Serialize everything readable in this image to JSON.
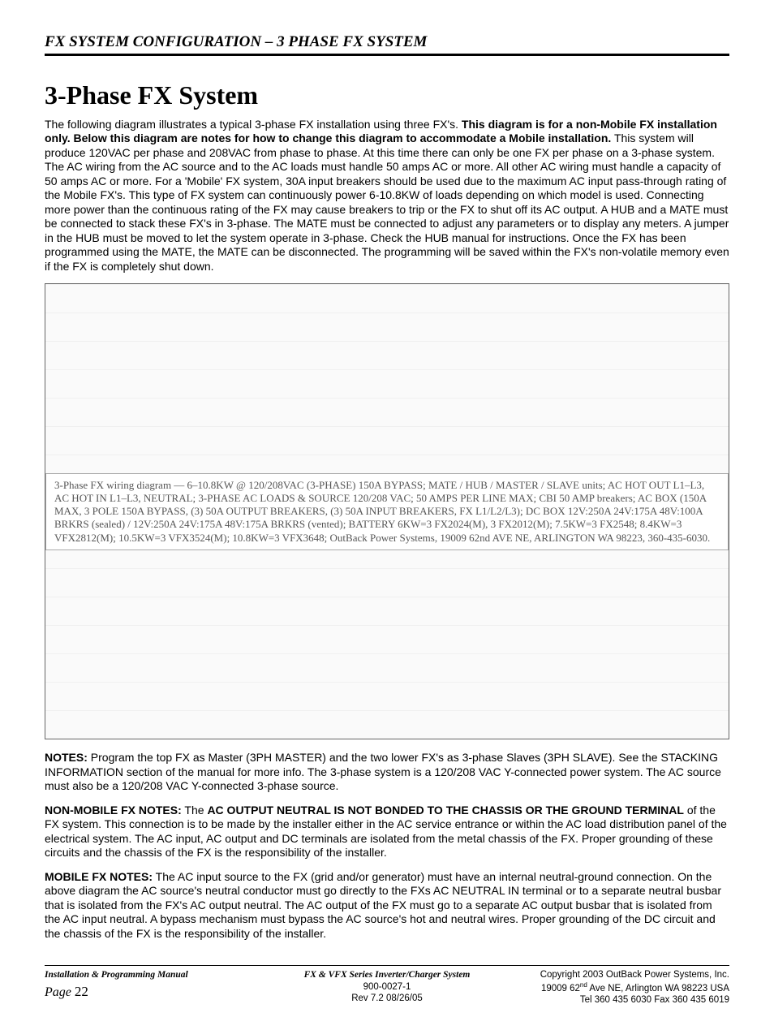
{
  "header": {
    "title": "FX SYSTEM CONFIGURATION – 3 PHASE FX SYSTEM"
  },
  "main": {
    "heading": "3-Phase FX System",
    "intro_lead": "The following diagram illustrates a typical 3-phase FX installation using three FX's.  ",
    "intro_bold": "This diagram is for a non-Mobile FX installation only.  Below this diagram are notes for how to change this diagram to accommodate a Mobile installation.",
    "intro_tail": "  This system will produce 120VAC per phase and 208VAC from phase to phase.  At this time there can only be one FX per phase on a 3-phase system.  The AC wiring from the AC source and to the AC loads must handle 50 amps AC or more.  All other AC wiring must handle a capacity of 50 amps AC or more.  For a 'Mobile' FX system, 30A input breakers should be used due to the maximum AC input pass-through rating of the Mobile FX's.  This type of FX system can continuously power 6-10.8KW of loads depending on which model is used.  Connecting more power than the continuous rating of the FX may cause breakers to trip or the FX to shut off its AC output.  A HUB and a MATE must be connected to stack these FX's in 3-phase.  The MATE must be connected to adjust any parameters or to display any meters.  A jumper in the HUB must be moved to let the system operate in 3-phase.  Check the HUB manual for instructions.  Once the FX has been programmed using the MATE, the MATE can be disconnected.  The programming will be saved within the FX's non-volatile memory even if the FX is completely shut down.",
    "diagram_alt": "3-Phase FX wiring diagram — 6–10.8KW @ 120/208VAC (3-PHASE) 150A BYPASS; MATE / HUB / MASTER / SLAVE units; AC HOT OUT L1–L3, AC HOT IN L1–L3, NEUTRAL; 3-PHASE AC LOADS & SOURCE 120/208 VAC; 50 AMPS PER LINE MAX; CBI 50 AMP breakers; AC BOX (150A MAX, 3 POLE 150A BYPASS, (3) 50A OUTPUT BREAKERS, (3) 50A INPUT BREAKERS, FX L1/L2/L3); DC BOX 12V:250A 24V:175A 48V:100A BRKRS (sealed) / 12V:250A 24V:175A 48V:175A BRKRS (vented); BATTERY 6KW=3 FX2024(M), 3 FX2012(M); 7.5KW=3 FX2548; 8.4KW=3 VFX2812(M); 10.5KW=3 VFX3524(M); 10.8KW=3 VFX3648; OutBack Power Systems, 19009 62nd AVE NE, ARLINGTON WA 98223, 360-435-6030.",
    "notes_label": "NOTES:",
    "notes_text": "  Program the top FX as Master (3PH MASTER) and the two lower FX's as 3-phase Slaves (3PH SLAVE).  See the STACKING INFORMATION section of the manual for more info.  The 3-phase system is a 120/208 VAC Y-connected power system.  The AC source must also be a 120/208 VAC Y-connected 3-phase source.",
    "nonmobile_label": "NON-MOBILE FX NOTES:",
    "nonmobile_lead": "  The ",
    "nonmobile_bold": "AC OUTPUT NEUTRAL IS NOT BONDED TO THE CHASSIS OR THE GROUND TERMINAL",
    "nonmobile_tail": " of the FX system.  This connection is to be made by the installer either in the AC service entrance or within the AC load distribution panel of the electrical system.  The AC input, AC output and DC terminals are isolated from the metal chassis of the FX. Proper grounding of these circuits and the chassis of the FX is the responsibility of the installer.",
    "mobile_label": "MOBILE FX NOTES:",
    "mobile_text": "  The AC input source to the FX (grid and/or generator) must have an internal neutral-ground connection.  On the above diagram the AC source's neutral conductor must go directly to the FXs AC NEUTRAL IN terminal or to a separate neutral busbar that is isolated from the FX's AC output neutral.  The AC output of the FX must go to a separate AC output busbar that is isolated from the AC input neutral.  A bypass mechanism must bypass the AC source's hot and neutral wires.  Proper grounding of the DC circuit and the chassis of the FX is the responsibility of the installer."
  },
  "footer": {
    "left1": "Installation & Programming Manual",
    "page_label": "Page ",
    "page_num": "22",
    "center1": "FX & VFX Series Inverter/Charger System",
    "center2": "900-0027-1",
    "center3": "Rev 7.2     08/26/05",
    "right1": "Copyright 2003       OutBack Power Systems, Inc.",
    "right2a": "19009 62",
    "right2sup": "nd",
    "right2b": " Ave NE, Arlington  WA 98223 USA",
    "right3": "Tel 360 435 6030   Fax 360 435 6019"
  }
}
